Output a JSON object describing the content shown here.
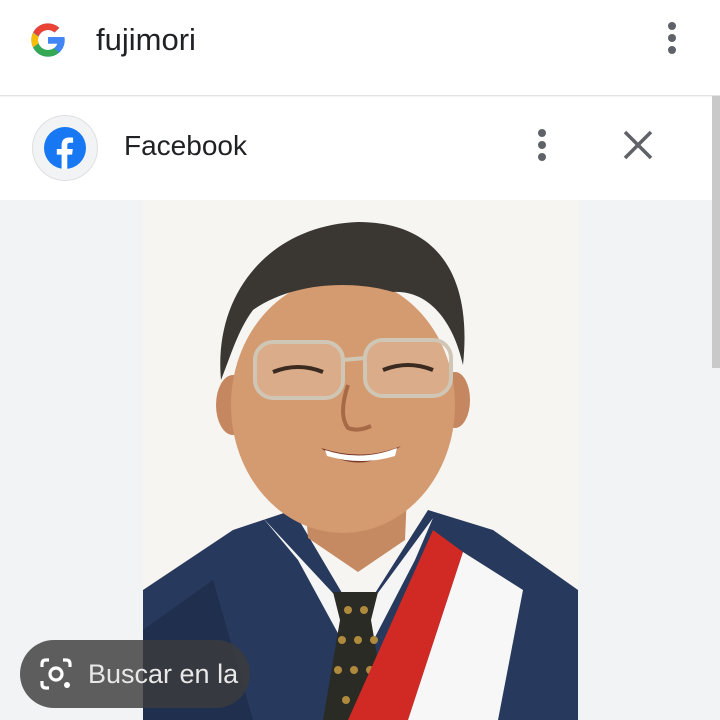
{
  "search": {
    "query": "fujimori",
    "icon": "google-g-icon",
    "menu_icon": "more-vert-icon"
  },
  "source_panel": {
    "site_name": "Facebook",
    "site_icon": "facebook-icon",
    "menu_icon": "more-vert-icon",
    "close_icon": "close-icon"
  },
  "image_viewer": {
    "image_icon": "portrait-photo"
  },
  "lens": {
    "label": "Buscar en la",
    "icon": "lens-icon"
  },
  "colors": {
    "background": "#f1f3f4",
    "bar": "#ffffff",
    "facebook_blue": "#1877f2",
    "text": "#202124"
  }
}
